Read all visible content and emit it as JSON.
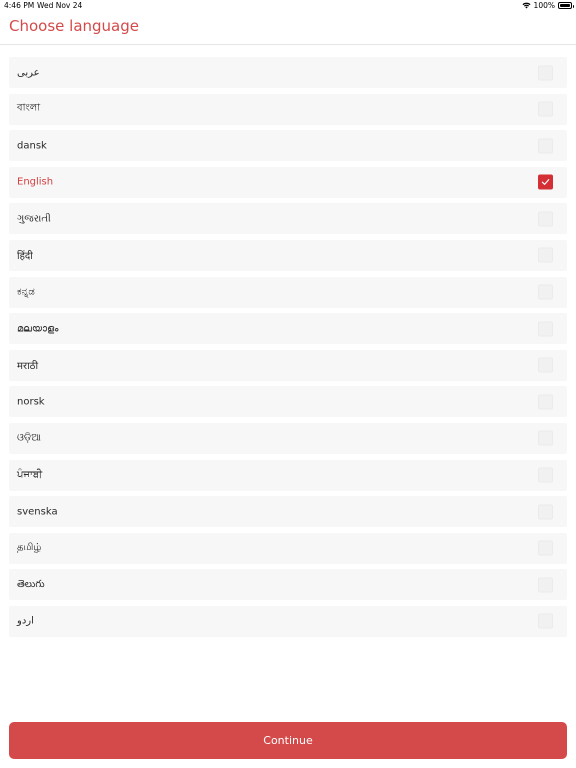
{
  "status_bar": {
    "time": "4:46 PM",
    "date": "Wed Nov 24",
    "battery": "100%",
    "icons": [
      "wifi-icon",
      "battery-icon"
    ]
  },
  "header": {
    "title": "Choose language"
  },
  "languages": [
    {
      "label": "عربى",
      "checked": false
    },
    {
      "label": "বাংলা",
      "checked": false
    },
    {
      "label": "dansk",
      "checked": false
    },
    {
      "label": "English",
      "checked": true
    },
    {
      "label": "ગુજરાતી",
      "checked": false
    },
    {
      "label": "हिंदी",
      "checked": false
    },
    {
      "label": "ಕನ್ನಡ",
      "checked": false
    },
    {
      "label": "മലയാളം",
      "checked": false
    },
    {
      "label": "मराठी",
      "checked": false
    },
    {
      "label": "norsk",
      "checked": false
    },
    {
      "label": "ଓଡ଼ିଆ",
      "checked": false
    },
    {
      "label": "ਪੰਜਾਬੀ",
      "checked": false
    },
    {
      "label": "svenska",
      "checked": false
    },
    {
      "label": "தமிழ்",
      "checked": false
    },
    {
      "label": "తెలుగు",
      "checked": false
    },
    {
      "label": "اردو",
      "checked": false
    }
  ],
  "footer": {
    "continue_label": "Continue"
  },
  "colors": {
    "accent": "#d44a4a",
    "checkbox_checked": "#d42f35",
    "row_background": "#f7f7f7"
  }
}
